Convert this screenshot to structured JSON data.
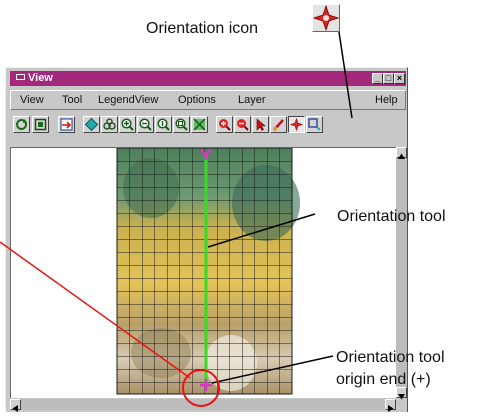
{
  "callouts": {
    "orientation_icon": "Orientation icon",
    "orientation_tool": "Orientation tool",
    "origin_line1": "Orientation tool",
    "origin_line2": "origin end (+)"
  },
  "window": {
    "title": "View",
    "controls": {
      "minimize": "_",
      "maximize": "□",
      "close": "×"
    }
  },
  "menu": {
    "view": "View",
    "tool": "Tool",
    "legendview": "LegendView",
    "options": "Options",
    "layer": "Layer",
    "help": "Help"
  },
  "toolbar": {
    "icons": [
      "redraw-icon",
      "full-view-icon",
      "pan-icon",
      "move-icon",
      "locate-icon",
      "zoom-in-icon",
      "zoom-out-icon",
      "zoom-one-icon",
      "zoom-box-icon",
      "zoom-selected-icon",
      "red-zoom-in-icon",
      "red-zoom-out-icon",
      "pointer-icon",
      "measure-icon",
      "orientation-icon",
      "select-icon"
    ]
  },
  "colors": {
    "title_bar": "#a3277a",
    "window_bg": "#c8c8c8",
    "orientation_line": "#33dd22",
    "orientation_markers": "#dd33cc",
    "callout_circle": "#ee1111"
  }
}
